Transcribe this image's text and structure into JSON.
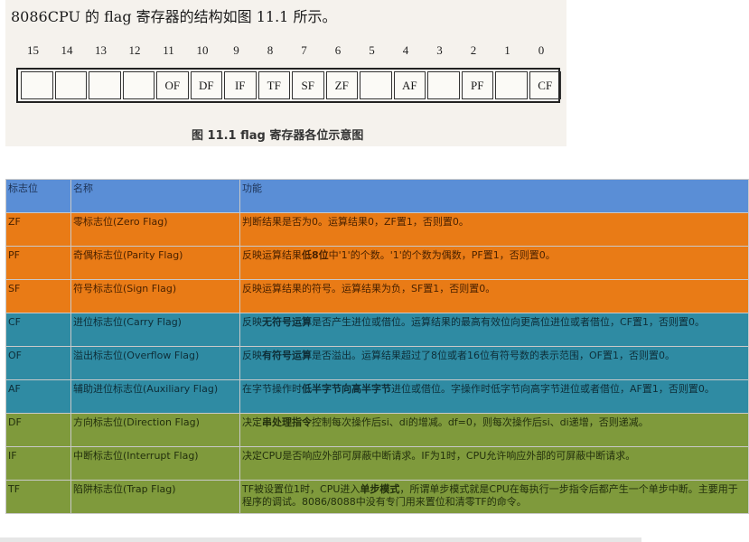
{
  "figure": {
    "intro": "8086CPU 的 flag 寄存器的结构如图 11.1 所示。",
    "caption": "图 11.1   flag 寄存器各位示意图",
    "bits": [
      {
        "num": "15",
        "label": ""
      },
      {
        "num": "14",
        "label": ""
      },
      {
        "num": "13",
        "label": ""
      },
      {
        "num": "12",
        "label": ""
      },
      {
        "num": "11",
        "label": "OF"
      },
      {
        "num": "10",
        "label": "DF"
      },
      {
        "num": "9",
        "label": "IF"
      },
      {
        "num": "8",
        "label": "TF"
      },
      {
        "num": "7",
        "label": "SF"
      },
      {
        "num": "6",
        "label": "ZF"
      },
      {
        "num": "5",
        "label": ""
      },
      {
        "num": "4",
        "label": "AF"
      },
      {
        "num": "3",
        "label": ""
      },
      {
        "num": "2",
        "label": "PF"
      },
      {
        "num": "1",
        "label": ""
      },
      {
        "num": "0",
        "label": "CF"
      }
    ]
  },
  "table": {
    "headers": [
      "标志位",
      "名称",
      "功能"
    ],
    "rows": [
      {
        "flag": "ZF",
        "name": "零标志位(Zero Flag)",
        "desc_a": "判断结果是否为0。运算结果0，ZF置1，否则置0。",
        "desc_bold": "",
        "desc_b": ""
      },
      {
        "flag": "PF",
        "name": "奇偶标志位(Parity Flag)",
        "desc_a": "反映运算结果",
        "desc_bold": "低8位",
        "desc_b": "中'1'的个数。'1'的个数为偶数，PF置1，否则置0。"
      },
      {
        "flag": "SF",
        "name": "符号标志位(Sign Flag)",
        "desc_a": "反映运算结果的符号。运算结果为负，SF置1，否则置0。",
        "desc_bold": "",
        "desc_b": ""
      },
      {
        "flag": "CF",
        "name": "进位标志位(Carry Flag)",
        "desc_a": "反映",
        "desc_bold": "无符号运算",
        "desc_b": "是否产生进位或借位。运算结果的最高有效位向更高位进位或者借位，CF置1，否则置0。"
      },
      {
        "flag": "OF",
        "name": "溢出标志位(Overflow Flag)",
        "desc_a": "反映",
        "desc_bold": "有符号运算",
        "desc_b": "是否溢出。运算结果超过了8位或者16位有符号数的表示范围，OF置1，否则置0。"
      },
      {
        "flag": "AF",
        "name": "辅助进位标志位(Auxiliary Flag)",
        "desc_a": "在字节操作时",
        "desc_bold": "低半字节向高半字节",
        "desc_b": "进位或借位。字操作时低字节向高字节进位或者借位，AF置1，否则置0。"
      },
      {
        "flag": "DF",
        "name": "方向标志位(Direction Flag)",
        "desc_a": "决定",
        "desc_bold": "串处理指令",
        "desc_b": "控制每次操作后si、di的增减。df=0，则每次操作后si、di递增，否则递减。"
      },
      {
        "flag": "IF",
        "name": "中断标志位(Interrupt Flag)",
        "desc_a": "决定CPU是否响应外部可屏蔽中断请求。IF为1时，CPU允许响应外部的可屏蔽中断请求。",
        "desc_bold": "",
        "desc_b": ""
      },
      {
        "flag": "TF",
        "name": "陷阱标志位(Trap Flag)",
        "desc_a": "TF被设置位1时，CPU进入",
        "desc_bold": "单步模式",
        "desc_b": "，所谓单步模式就是CPU在每执行一步指令后都产生一个单步中断。主要用于程序的调试。8086/8088中没有专门用来置位和清零TF的命令。"
      }
    ]
  }
}
